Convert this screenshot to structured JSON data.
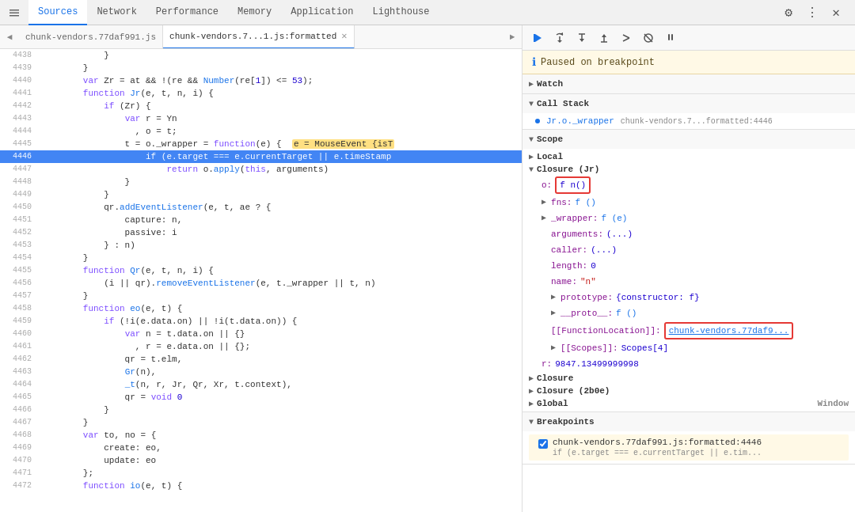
{
  "tabs": {
    "items": [
      {
        "label": "Sources",
        "active": true
      },
      {
        "label": "Network",
        "active": false
      },
      {
        "label": "Performance",
        "active": false
      },
      {
        "label": "Memory",
        "active": false
      },
      {
        "label": "Application",
        "active": false
      },
      {
        "label": "Lighthouse",
        "active": false
      }
    ]
  },
  "fileTabs": {
    "items": [
      {
        "label": "chunk-vendors.77daf991.js",
        "active": false,
        "closeable": false
      },
      {
        "label": "chunk-vendors.7...1.js:formatted",
        "active": true,
        "closeable": true
      }
    ]
  },
  "debugToolbar": {
    "paused_label": "Paused on breakpoint"
  },
  "codeLines": [
    {
      "num": "4438",
      "code": "            }",
      "highlight": false
    },
    {
      "num": "4439",
      "code": "        }",
      "highlight": false
    },
    {
      "num": "4440",
      "code": "        var Zr = at && !(re && Number(re[1]) <= 53);",
      "highlight": false
    },
    {
      "num": "4441",
      "code": "        function Jr(e, t, n, i) {",
      "highlight": false
    },
    {
      "num": "4442",
      "code": "            if (Zr) {",
      "highlight": false
    },
    {
      "num": "4443",
      "code": "                var r = Yn",
      "highlight": false
    },
    {
      "num": "4444",
      "code": "                  , o = t;",
      "highlight": false
    },
    {
      "num": "4445",
      "code": "                t = o._wrapper = function(e) {  e = MouseEvent {isT",
      "highlight": false
    },
    {
      "num": "4446",
      "code": "                    if (e.target === e.currentTarget || e.timeStamp",
      "highlight": true
    },
    {
      "num": "4447",
      "code": "                        return o.apply(this, arguments)",
      "highlight": false
    },
    {
      "num": "4448",
      "code": "                }",
      "highlight": false
    },
    {
      "num": "4449",
      "code": "            }",
      "highlight": false
    },
    {
      "num": "4450",
      "code": "            qr.addEventListener(e, t, ae ? {",
      "highlight": false
    },
    {
      "num": "4451",
      "code": "                capture: n,",
      "highlight": false
    },
    {
      "num": "4452",
      "code": "                passive: i",
      "highlight": false
    },
    {
      "num": "4453",
      "code": "            } : n)",
      "highlight": false
    },
    {
      "num": "4454",
      "code": "        }",
      "highlight": false
    },
    {
      "num": "4455",
      "code": "        function Qr(e, t, n, i) {",
      "highlight": false
    },
    {
      "num": "4456",
      "code": "            (i || qr).removeEventListener(e, t._wrapper || t, n)",
      "highlight": false
    },
    {
      "num": "4457",
      "code": "        }",
      "highlight": false
    },
    {
      "num": "4458",
      "code": "        function eo(e, t) {",
      "highlight": false
    },
    {
      "num": "4459",
      "code": "            if (!i(e.data.on) || !i(t.data.on)) {",
      "highlight": false
    },
    {
      "num": "4460",
      "code": "                var n = t.data.on || {}",
      "highlight": false
    },
    {
      "num": "4461",
      "code": "                  , r = e.data.on || {};",
      "highlight": false
    },
    {
      "num": "4462",
      "code": "                qr = t.elm,",
      "highlight": false
    },
    {
      "num": "4463",
      "code": "                Gr(n),",
      "highlight": false
    },
    {
      "num": "4464",
      "code": "                _t(n, r, Jr, Qr, Xr, t.context),",
      "highlight": false
    },
    {
      "num": "4465",
      "code": "                qr = void 0",
      "highlight": false
    },
    {
      "num": "4466",
      "code": "            }",
      "highlight": false
    },
    {
      "num": "4467",
      "code": "        }",
      "highlight": false
    },
    {
      "num": "4468",
      "code": "        var to, no = {",
      "highlight": false
    },
    {
      "num": "4469",
      "code": "            create: eo,",
      "highlight": false
    },
    {
      "num": "4470",
      "code": "            update: eo",
      "highlight": false
    },
    {
      "num": "4471",
      "code": "        };",
      "highlight": false
    },
    {
      "num": "4472",
      "code": "        function io(e, t) {",
      "highlight": false
    }
  ],
  "rightPanel": {
    "breakpointBar": "Paused on breakpoint",
    "watchLabel": "Watch",
    "callStackLabel": "Call Stack",
    "callStackItems": [
      {
        "fn": "Jr.o._wrapper",
        "file": "chunk-vendors.7...formatted:4446"
      }
    ],
    "scopeLabel": "Scope",
    "localLabel": "Local",
    "closureLabel": "Closure (Jr)",
    "closureItems": [
      {
        "name": "o",
        "value": "f n()",
        "highlighted": true
      },
      {
        "name": "fns",
        "value": "f ()",
        "expanded": true
      },
      {
        "name": "_wrapper",
        "value": "f (e)",
        "expanded": true
      },
      {
        "name": "arguments",
        "value": "(...)",
        "expanded": false
      },
      {
        "name": "caller",
        "value": "(...)",
        "expanded": false
      },
      {
        "name": "length",
        "value": "0",
        "type": "num"
      },
      {
        "name": "name",
        "value": "\"n\"",
        "type": "str"
      },
      {
        "name": "prototype",
        "value": "{constructor: f}",
        "expanded": true
      },
      {
        "name": "__proto__",
        "value": "f ()",
        "expanded": true
      },
      {
        "name": "[[FunctionLocation]]",
        "value": "chunk-vendors.77daf9...",
        "isLink": true
      },
      {
        "name": "[[Scopes]]",
        "value": "Scopes[4]",
        "expanded": true
      },
      {
        "name": "r",
        "value": "9847.13499999998",
        "type": "num"
      }
    ],
    "closure2Label": "Closure",
    "closure3Label": "Closure (2b0e)",
    "globalLabel": "Global",
    "globalValue": "Window",
    "breakpointsLabel": "Breakpoints",
    "breakpointItem": {
      "file": "chunk-vendors.77daf991.js:formatted:4446",
      "code": "if (e.target === e.currentTarget || e.tim..."
    }
  }
}
